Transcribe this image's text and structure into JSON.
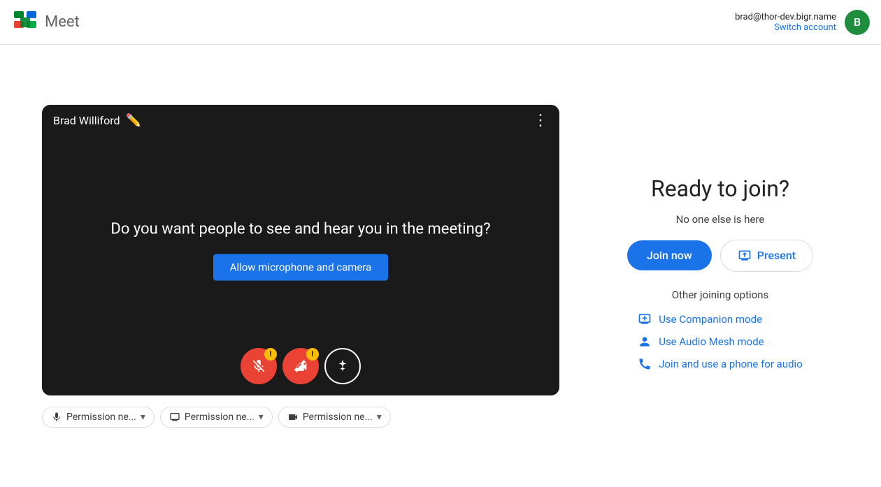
{
  "header": {
    "app_name": "Meet",
    "account_email": "brad@thor-dev.bigr.name",
    "switch_account_label": "Switch account",
    "avatar_letter": "B",
    "avatar_color": "#1e8e3e"
  },
  "video_preview": {
    "user_name": "Brad Williford",
    "question_text": "Do you want people to see and hear you in the meeting?",
    "allow_button_label": "Allow microphone and camera"
  },
  "permissions": {
    "mic_label": "Permission ne...",
    "screen_label": "Permission ne...",
    "camera_label": "Permission ne..."
  },
  "right_panel": {
    "ready_title": "Ready to join?",
    "no_one_text": "No one else is here",
    "join_now_label": "Join now",
    "present_label": "Present",
    "other_options_title": "Other joining options",
    "options": [
      {
        "id": "companion",
        "label": "Use Companion mode"
      },
      {
        "id": "audio-mesh",
        "label": "Use Audio Mesh mode"
      },
      {
        "id": "phone-audio",
        "label": "Join and use a phone for audio"
      }
    ]
  }
}
